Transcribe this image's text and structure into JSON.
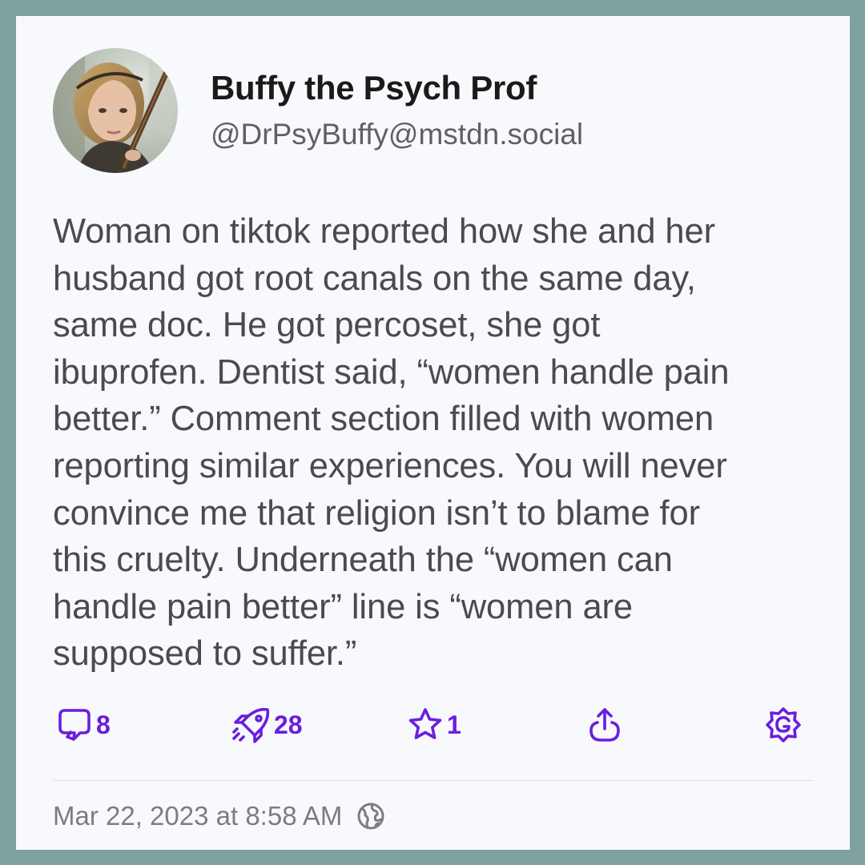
{
  "author": {
    "display_name": "Buffy the Psych Prof",
    "handle": "@DrPsyBuffy@mstdn.social"
  },
  "post": {
    "lines": [
      "Woman on tiktok reported how she and her",
      "husband got root canals on the same day,",
      "same doc. He got percoset, she got",
      "ibuprofen. Dentist said, “women handle pain",
      "better.” Comment section filled with women",
      "reporting similar experiences.  You will never",
      "convince me that religion isn’t to blame for",
      "this cruelty. Underneath the “women can",
      "handle pain better” line is “women are",
      "supposed to suffer.”"
    ]
  },
  "actions": {
    "reply_count": "8",
    "boost_count": "28",
    "favorite_count": "1",
    "icons": [
      "reply-icon",
      "boost-icon",
      "favorite-icon",
      "share-icon",
      "more-options-icon"
    ]
  },
  "meta": {
    "timestamp": "Mar 22, 2023 at 8:58 AM",
    "visibility_icon": "globe-icon"
  },
  "colors": {
    "frame": "#7fa19f",
    "card": "#f8f9fc",
    "accent": "#6a1ee0",
    "body_text": "#4a4a50",
    "muted_text": "#7c7c84"
  }
}
